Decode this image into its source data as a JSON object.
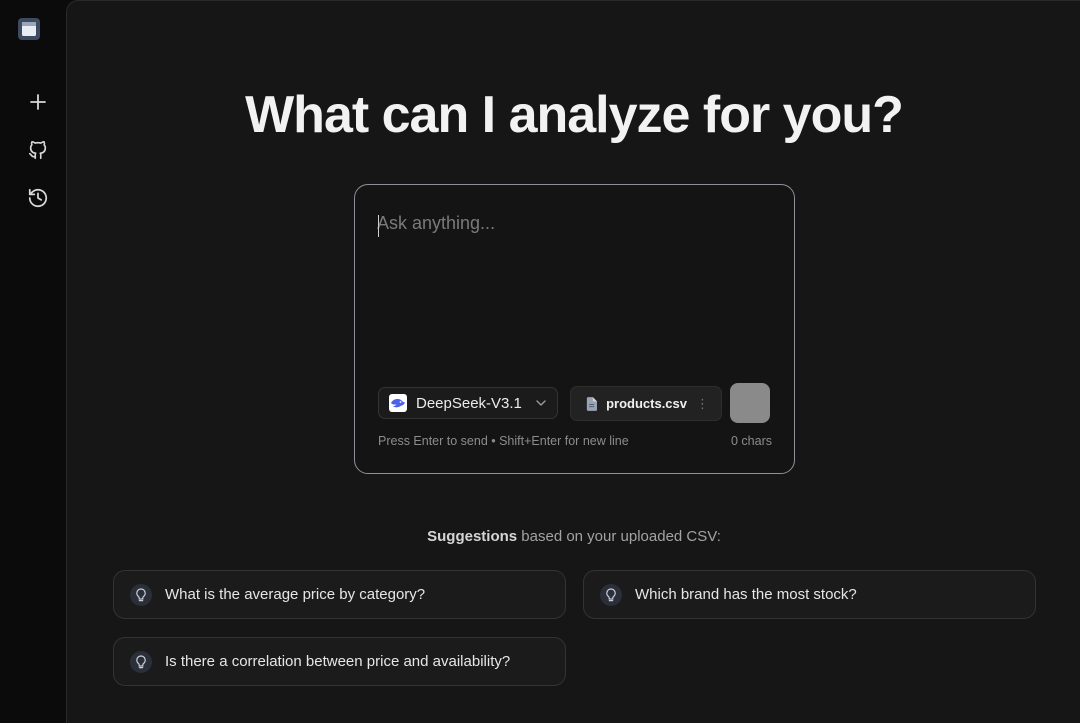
{
  "sidebar": {
    "items": [
      {
        "name": "new-chat",
        "icon": "plus-icon"
      },
      {
        "name": "github",
        "icon": "github-icon"
      },
      {
        "name": "history",
        "icon": "history-icon"
      }
    ]
  },
  "headline": "What can I analyze for you?",
  "composer": {
    "placeholder": "Ask anything...",
    "value": "",
    "model": "DeepSeek-V3.1",
    "attached_file": "products.csv",
    "hint": "Press Enter to send • Shift+Enter for new line",
    "char_count": "0 chars"
  },
  "suggestions": {
    "caption_bold": "Suggestions",
    "caption_rest": " based on your uploaded CSV:",
    "items": [
      "What is the average price by category?",
      "Which brand has the most stock?",
      "Is there a correlation between price and availability?"
    ]
  },
  "colors": {
    "background": "#0b0b0b",
    "panel": "#161616",
    "send_button": "#8a8a8a",
    "composer_border": "#8f8f99"
  }
}
